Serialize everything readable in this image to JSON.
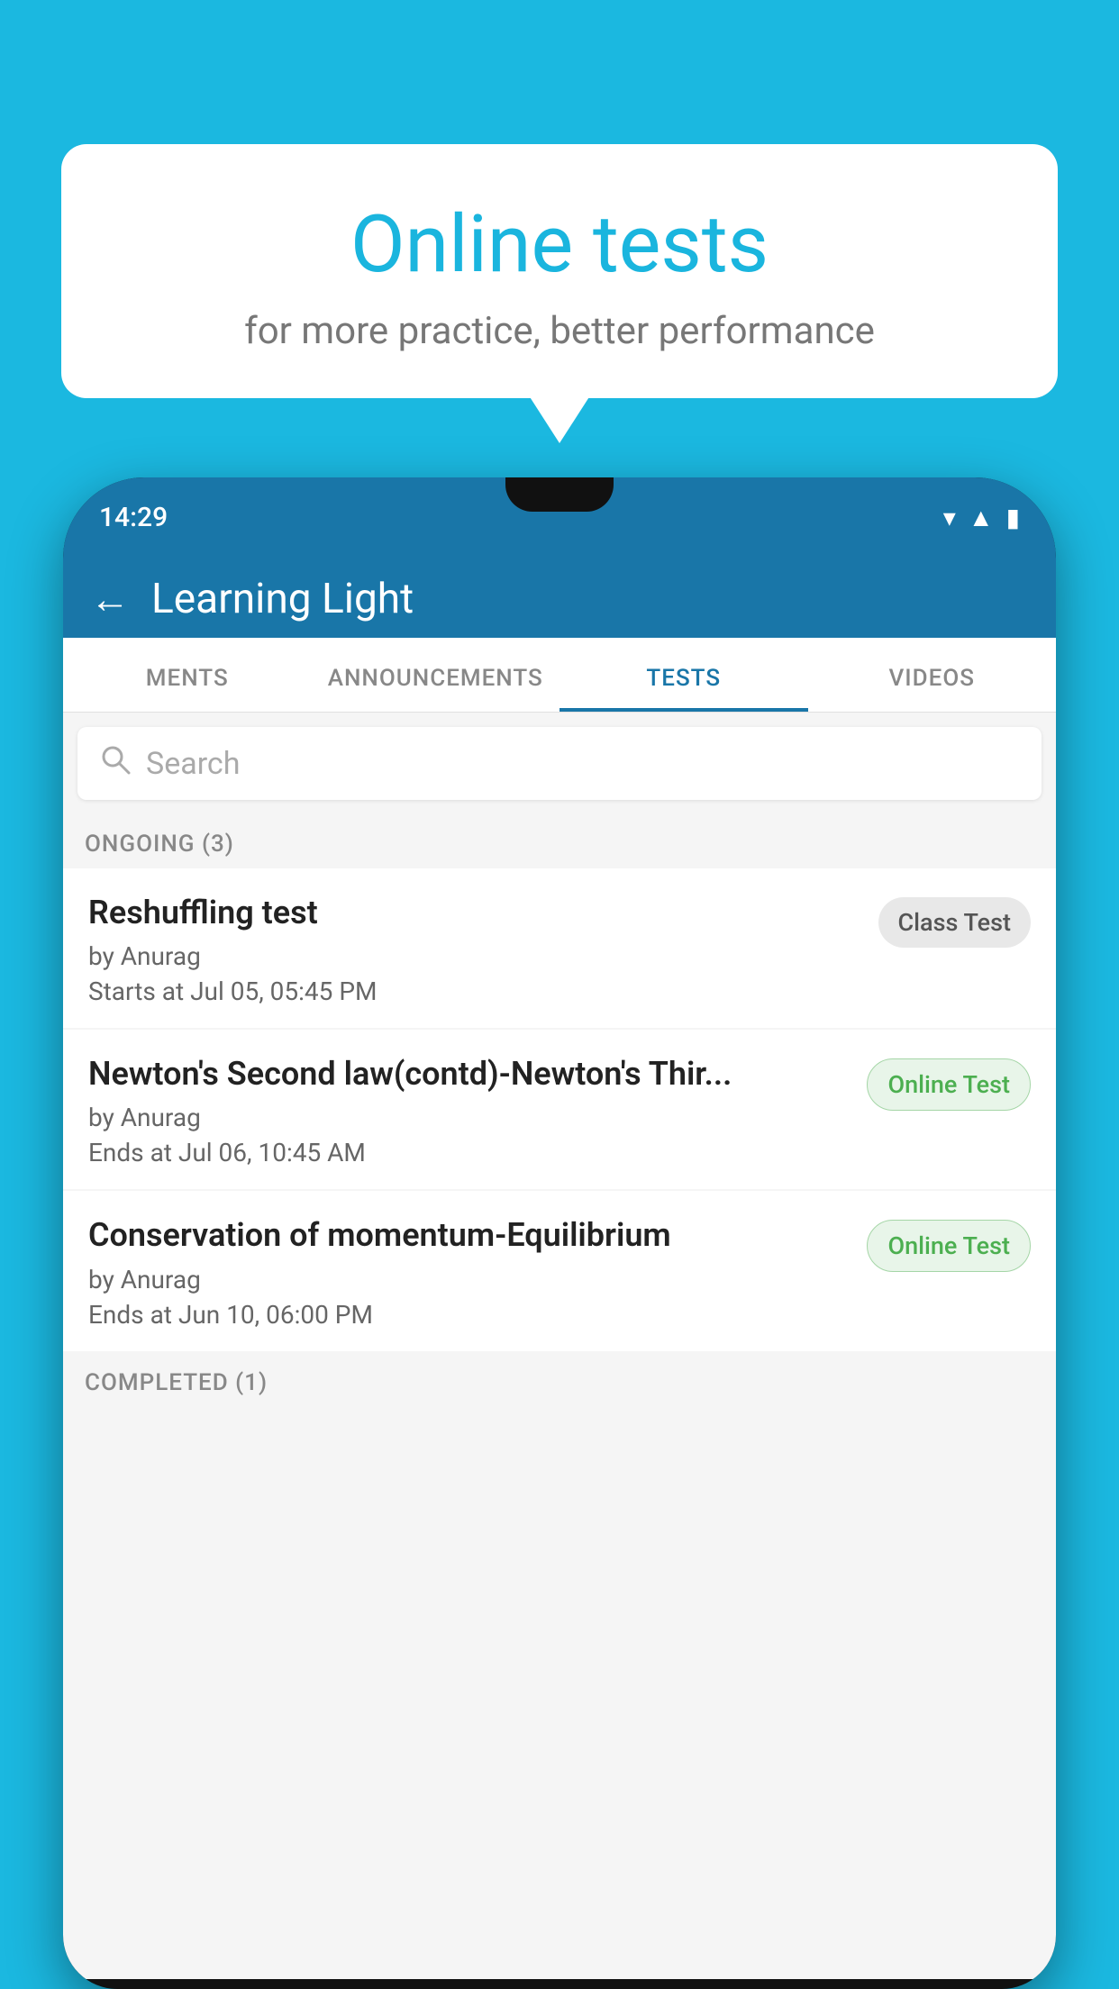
{
  "background_color": "#1bb8e0",
  "speech_bubble": {
    "title": "Online tests",
    "subtitle": "for more practice, better performance"
  },
  "phone": {
    "status_bar": {
      "time": "14:29",
      "icons": [
        "wifi",
        "signal",
        "battery"
      ]
    },
    "app_header": {
      "title": "Learning Light",
      "back_label": "←"
    },
    "tabs": [
      {
        "label": "MENTS",
        "active": false
      },
      {
        "label": "ANNOUNCEMENTS",
        "active": false
      },
      {
        "label": "TESTS",
        "active": true
      },
      {
        "label": "VIDEOS",
        "active": false
      }
    ],
    "search": {
      "placeholder": "Search"
    },
    "ongoing_section": {
      "header": "ONGOING (3)",
      "items": [
        {
          "name": "Reshuffling test",
          "author": "by Anurag",
          "date": "Starts at  Jul 05, 05:45 PM",
          "badge": "Class Test",
          "badge_type": "class"
        },
        {
          "name": "Newton's Second law(contd)-Newton's Thir...",
          "author": "by Anurag",
          "date": "Ends at  Jul 06, 10:45 AM",
          "badge": "Online Test",
          "badge_type": "online"
        },
        {
          "name": "Conservation of momentum-Equilibrium",
          "author": "by Anurag",
          "date": "Ends at  Jun 10, 06:00 PM",
          "badge": "Online Test",
          "badge_type": "online"
        }
      ]
    },
    "completed_section": {
      "header": "COMPLETED (1)"
    }
  }
}
